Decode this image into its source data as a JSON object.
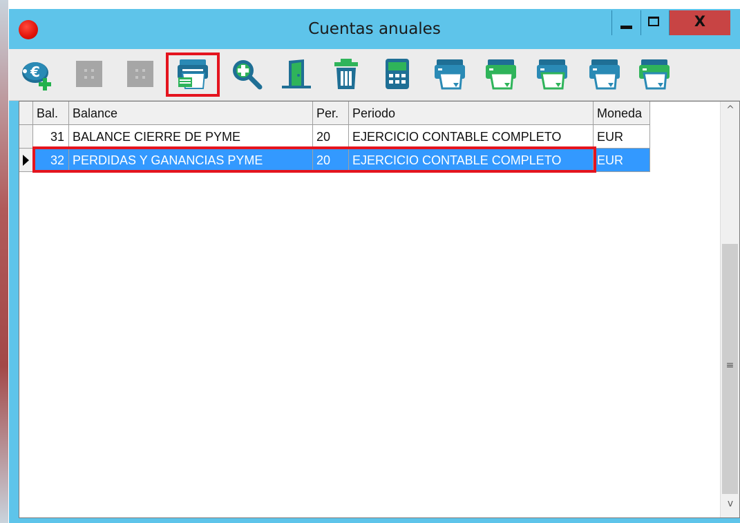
{
  "window": {
    "title": "Cuentas anuales",
    "close_label": "X"
  },
  "toolbar": {
    "buttons": [
      {
        "name": "add-account-icon",
        "enabled": true
      },
      {
        "name": "disabled-button-icon",
        "enabled": false
      },
      {
        "name": "disabled-button-icon",
        "enabled": false
      },
      {
        "name": "print-report-icon",
        "enabled": true,
        "highlighted": true
      },
      {
        "name": "zoom-search-icon",
        "enabled": true
      },
      {
        "name": "exit-door-icon",
        "enabled": true
      },
      {
        "name": "trash-icon",
        "enabled": true
      },
      {
        "name": "calculator-icon",
        "enabled": true
      },
      {
        "name": "print-blue-icon",
        "enabled": true
      },
      {
        "name": "print-green-icon",
        "enabled": true
      },
      {
        "name": "print-blue-icon",
        "enabled": true
      },
      {
        "name": "print-blue-icon",
        "enabled": true
      },
      {
        "name": "print-green-icon",
        "enabled": true
      }
    ]
  },
  "table": {
    "columns": [
      "Bal.",
      "Balance",
      "Per.",
      "Periodo",
      "Moneda"
    ],
    "rows": [
      {
        "bal": "31",
        "balance": "BALANCE CIERRE DE PYME",
        "per": "20",
        "periodo": "EJERCICIO CONTABLE COMPLETO",
        "moneda": "EUR",
        "selected": false
      },
      {
        "bal": "32",
        "balance": "PERDIDAS Y GANANCIAS PYME",
        "per": "20",
        "periodo": "EJERCICIO CONTABLE COMPLETO",
        "moneda": "EUR",
        "selected": true
      }
    ]
  },
  "scrollbar": {
    "up_glyph": "^",
    "down_glyph": "v",
    "grip_glyph": "≡"
  },
  "colors": {
    "titlebar": "#5ec4ea",
    "selection": "#3399ff",
    "highlight_box": "#e4141e",
    "close_button": "#c84444"
  }
}
